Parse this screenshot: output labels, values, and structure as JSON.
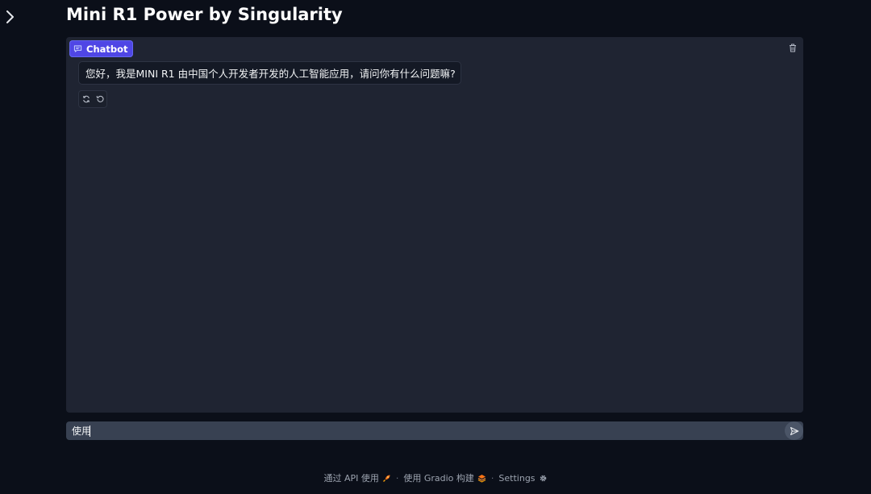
{
  "app": {
    "title": "Mini R1 Power by Singularity"
  },
  "chatbot": {
    "label": "Chatbot",
    "messages": [
      {
        "role": "bot",
        "text": "您好，我是MINI R1 由中国个人开发者开发的人工智能应用，请问你有什么问题嘛?"
      }
    ]
  },
  "input": {
    "value": "使用",
    "placeholder": ""
  },
  "footer": {
    "api_text": "通过 API 使用",
    "built_text": "使用 Gradio 构建",
    "settings_text": "Settings",
    "separator": "·"
  },
  "icons": {
    "sidebar_toggle": "chevron-right-icon",
    "chatbot_label": "chat-bubble-icon",
    "clear": "trash-icon",
    "retry": "refresh-icon",
    "undo": "undo-icon",
    "send": "send-arrow-icon",
    "api": "rocket-icon",
    "gradio": "gradio-logo-icon",
    "settings": "gear-icon"
  },
  "colors": {
    "background": "#0b0f19",
    "panel": "#1f2432",
    "accent": "#4f46e5",
    "input": "#384152"
  }
}
